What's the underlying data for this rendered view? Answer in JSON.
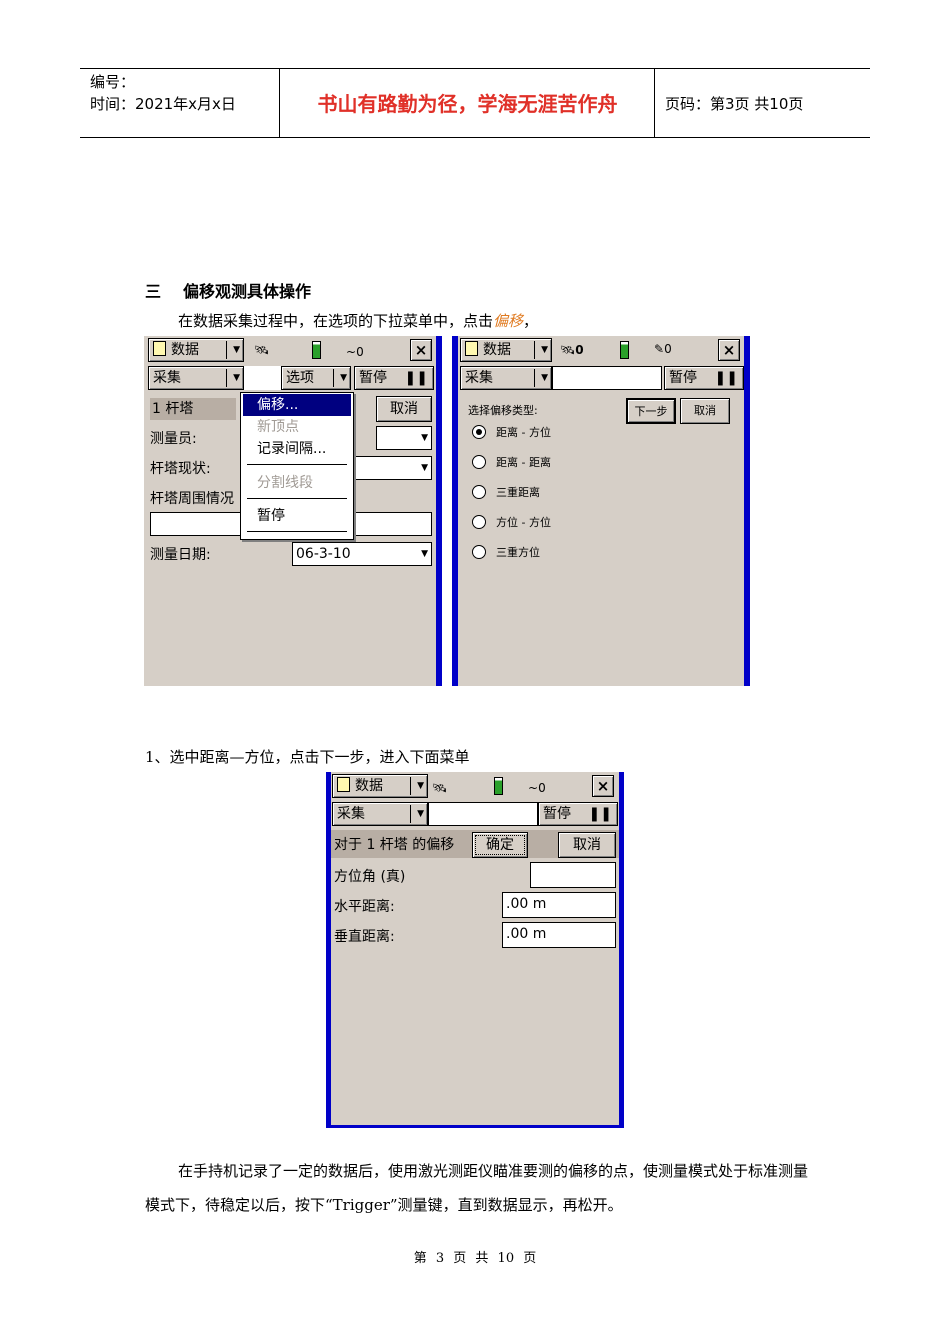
{
  "header": {
    "number_label": "编号：",
    "date_label": "时间：2021年x月x日",
    "motto": "书山有路勤为径，学海无涯苦作舟",
    "page_label": "页码：第3页  共10页"
  },
  "section": {
    "number": "三",
    "title": "偏移观测具体操作"
  },
  "intro": {
    "text": "在数据采集过程中，在选项的下拉菜单中，点击",
    "em": "偏移",
    "tail": "，"
  },
  "screen1": {
    "data_menu": "数据",
    "collect_menu": "采集",
    "options_menu": "选项",
    "pause_btn": "暂停",
    "zero": "0",
    "item_title": "1 杆塔",
    "cancel_btn": "取消",
    "fields": [
      "测量员:",
      "杆塔现状:",
      "杆塔周围情况",
      "测量日期:"
    ],
    "date_value": "06-3-10",
    "menu_items": [
      "偏移...",
      "新顶点",
      "记录间隔...",
      "分割线段",
      "暂停"
    ]
  },
  "screen2": {
    "data_menu": "数据",
    "collect_menu": "采集",
    "pause_btn": "暂停",
    "zero_a": "0",
    "zero_b": "0",
    "prompt": "选择偏移类型:",
    "next_btn": "下一步",
    "cancel_btn": "取消",
    "options": [
      "距离 - 方位",
      "距离 - 距离",
      "三重距离",
      "方位 - 方位",
      "三重方位"
    ],
    "selected_index": 0
  },
  "step1": {
    "text": "1、选中距离—方位，点击下一步，进入下面菜单"
  },
  "screen3": {
    "data_menu": "数据",
    "collect_menu": "采集",
    "pause_btn": "暂停",
    "zero": "0",
    "title": "对于 1 杆塔 的偏移",
    "ok_btn": "确定",
    "cancel_btn": "取消",
    "azimuth_label": "方位角 (真)",
    "hdist_label": "水平距离:",
    "hdist_value": ".00 m",
    "vdist_label": "垂直距离:",
    "vdist_value": ".00 m"
  },
  "body_text": "在手持机记录了一定的数据后，使用激光测距仪瞄准要测的偏移的点，使测量模式处于标准测量模式下，待稳定以后，按下“Trigger”测量键，直到数据显示，再松开。",
  "footer": "第 3 页 共 10 页"
}
